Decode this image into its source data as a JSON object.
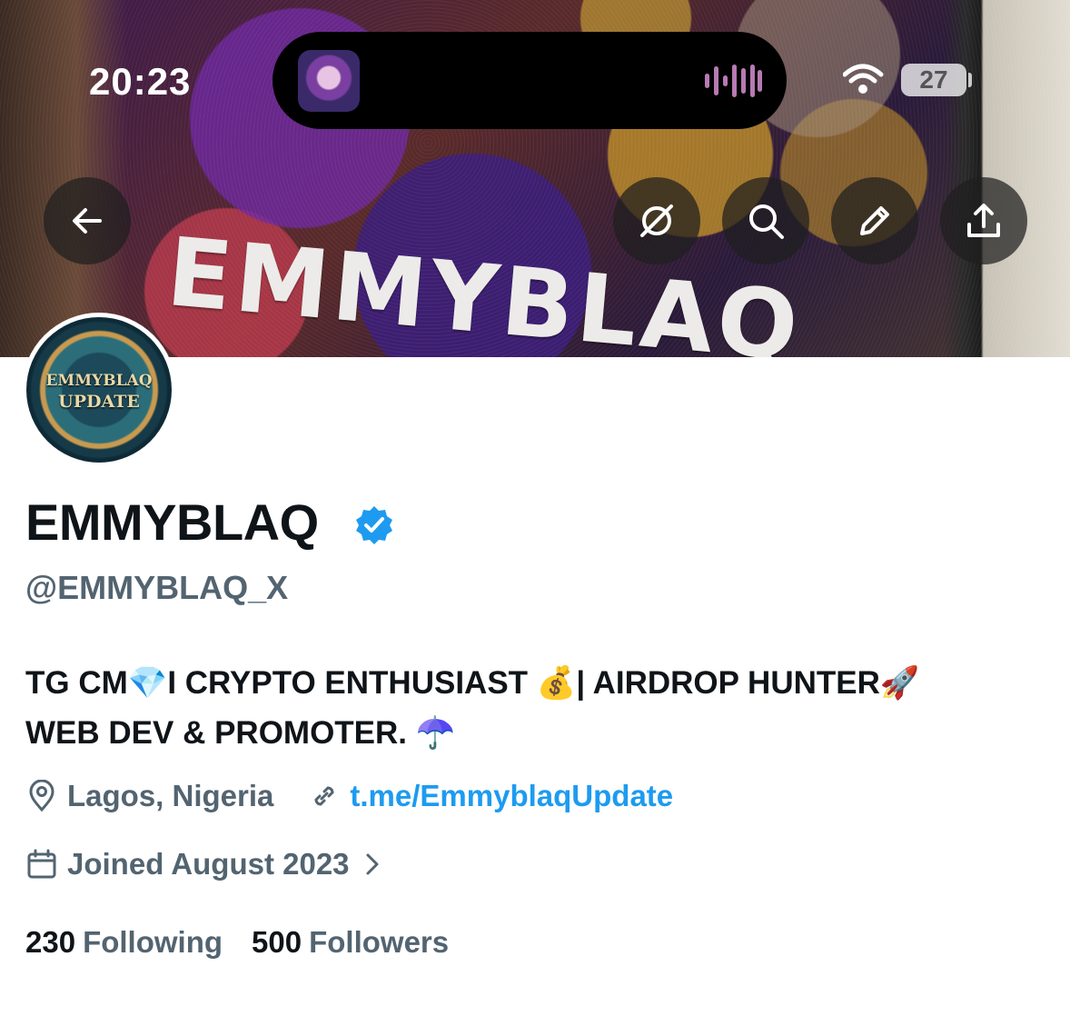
{
  "status_bar": {
    "time": "20:23",
    "battery": "27",
    "icons": [
      "wifi-icon",
      "battery-icon"
    ]
  },
  "banner": {
    "text": "EMMYBLAQ",
    "buttons": [
      "back-arrow-icon",
      "grok-icon",
      "search-icon",
      "edit-pencil-icon",
      "share-icon"
    ]
  },
  "avatar": {
    "line1": "EMMYBLAQ",
    "line2": "UPDATE"
  },
  "profile": {
    "display_name": "EMMYBLAQ",
    "verified": true,
    "handle": "@EMMYBLAQ_X",
    "bio_line1": "TG CM💎I CRYPTO ENTHUSIAST  💰| AIRDROP HUNTER🚀",
    "bio_line2": "WEB DEV & PROMOTER. ☂️",
    "location": "Lagos, Nigeria",
    "link": "t.me/EmmyblaqUpdate",
    "joined": "Joined August 2023",
    "following_count": "230",
    "following_label": "Following",
    "followers_count": "500",
    "followers_label": "Followers"
  },
  "colors": {
    "accent": "#1d9bf0",
    "secondary_text": "#536471",
    "primary_text": "#0f1419"
  }
}
